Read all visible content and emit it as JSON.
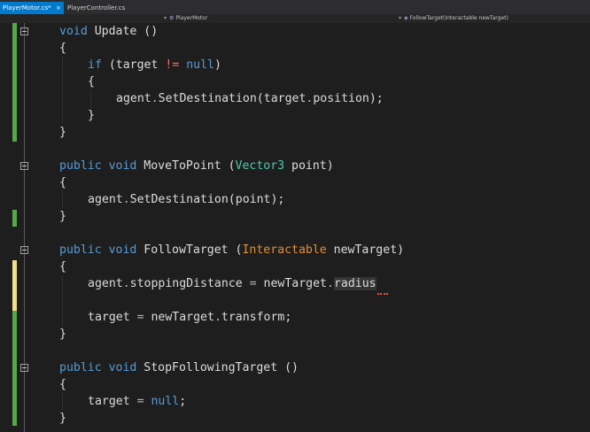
{
  "tabs": {
    "active": "PlayerMotor.cs*",
    "close_glyph": "×",
    "other": "PlayerController.cs"
  },
  "navigation": {
    "class_selector": "PlayerMotor",
    "member_selector": "FollowTarget(Interactable newTarget)"
  },
  "code": {
    "update_signature": {
      "kw": "void",
      "name": " Update ()"
    },
    "open_brace": "{",
    "close_brace": "}",
    "if_kw": "if",
    "if_open": " (target ",
    "neq": "!=",
    "null_kw": "null",
    "paren_close": ")",
    "set_dest_target": {
      "obj": "agent",
      "dot": ".",
      "call": "SetDestination(target",
      "dot2": ".",
      "rest": "position);"
    },
    "move_sig": {
      "kw1": "public",
      "kw2": "void",
      "name": " MoveToPoint (",
      "type": "Vector3",
      "rest": " point)"
    },
    "set_dest_point": {
      "obj": "agent",
      "dot": ".",
      "rest": "SetDestination(point);"
    },
    "follow_sig": {
      "kw1": "public",
      "kw2": "void",
      "name": " FollowTarget (",
      "type": "Interactable",
      "rest": " newTarget)"
    },
    "stopping_line": {
      "obj": "agent",
      "dot": ".",
      "prop": "stoppingDistance ",
      "eq": "=",
      "mid": " newTarget",
      "dot2": ".",
      "last": "radius"
    },
    "target_assign": {
      "lhs": "target ",
      "eq": "=",
      "mid": " newTarget",
      "dot": ".",
      "rest": "transform;"
    },
    "stop_sig": {
      "kw1": "public",
      "kw2": "void",
      "name": " StopFollowingTarget ()"
    },
    "target_null": {
      "lhs": "target ",
      "eq": "=",
      "semi": ";"
    }
  },
  "colors": {
    "editor_bg": "#1e1e1e",
    "keyword": "#569cd6",
    "type": "#4ec9b0",
    "interface_type": "#e08f36",
    "changed_saved": "#57a64a",
    "changed_unsaved": "#efe08a",
    "active_tab": "#007acc"
  }
}
